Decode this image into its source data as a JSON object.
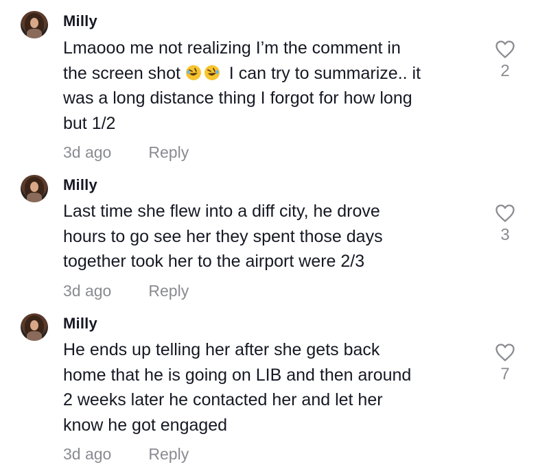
{
  "comments": [
    {
      "username": "Milly",
      "text_lines": [
        "Lmaooo me not realizing I’m the comment in",
        "the screen shot",
        "I can try to summarize.. it",
        "was a long distance thing I forgot for how long",
        "but 1/2"
      ],
      "emojis": [
        "rolling-on-floor-laughing-emoji",
        "rolling-on-floor-laughing-emoji"
      ],
      "time": "3d ago",
      "reply_label": "Reply",
      "like_count": "2"
    },
    {
      "username": "Milly",
      "text_lines": [
        "Last time she flew into a diff city, he drove",
        "hours to go see her they spent those days",
        "together took her to the airport were 2/3"
      ],
      "time": "3d ago",
      "reply_label": "Reply",
      "like_count": "3"
    },
    {
      "username": "Milly",
      "text_lines": [
        "He ends up telling her after she gets back",
        "home that he is going on LIB and then around",
        "2 weeks later he contacted her and let her",
        "know he got engaged"
      ],
      "time": "3d ago",
      "reply_label": "Reply",
      "like_count": "7"
    }
  ],
  "icons": {
    "like": "heart-outline-icon"
  }
}
